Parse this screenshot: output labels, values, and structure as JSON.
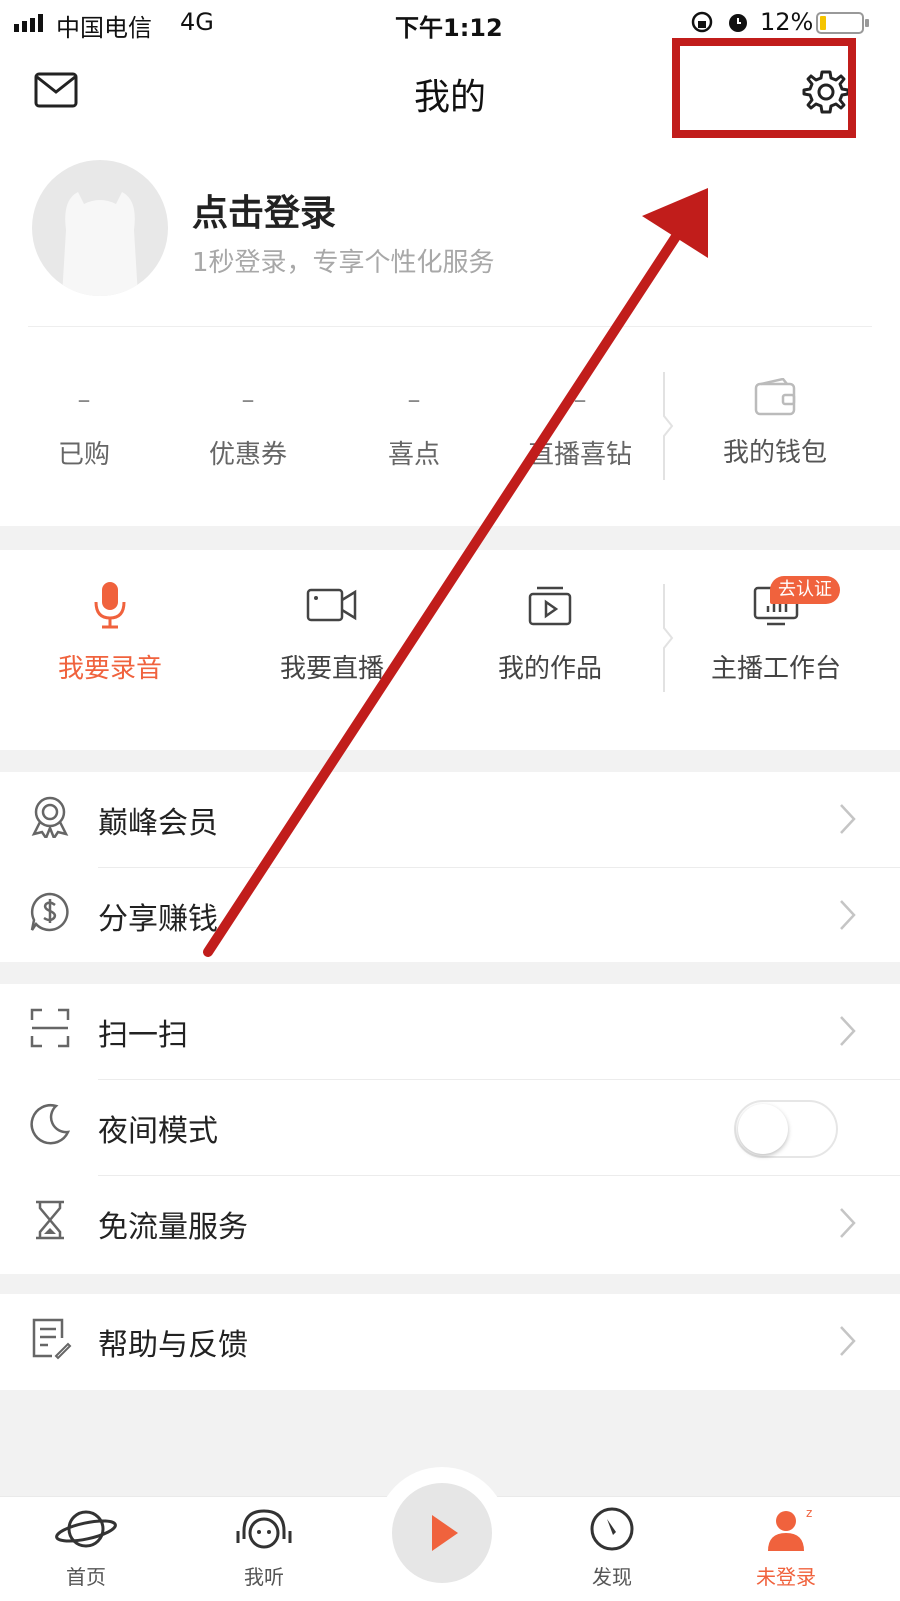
{
  "status_bar": {
    "carrier": "中国电信",
    "network": "4G",
    "time": "下午1:12",
    "battery": "12%"
  },
  "header": {
    "title": "我的",
    "mail_icon": "mail-icon",
    "settings_icon": "gear-icon"
  },
  "profile": {
    "login_title": "点击登录",
    "login_subtitle": "1秒登录，专享个性化服务"
  },
  "stats": [
    {
      "value": "–",
      "label": "已购"
    },
    {
      "value": "–",
      "label": "优惠券"
    },
    {
      "value": "–",
      "label": "喜点"
    },
    {
      "value": "–",
      "label": "直播喜钻"
    }
  ],
  "wallet": {
    "label": "我的钱包"
  },
  "tools": [
    {
      "label": "我要录音",
      "icon": "microphone-icon"
    },
    {
      "label": "我要直播",
      "icon": "video-camera-icon"
    },
    {
      "label": "我的作品",
      "icon": "works-icon"
    },
    {
      "label": "主播工作台",
      "icon": "workbench-icon",
      "badge": "去认证"
    }
  ],
  "list_group_1": [
    {
      "label": "巅峰会员",
      "icon": "badge-icon"
    },
    {
      "label": "分享赚钱",
      "icon": "dollar-icon"
    }
  ],
  "list_group_2": [
    {
      "label": "扫一扫",
      "icon": "scan-icon"
    },
    {
      "label": "夜间模式",
      "icon": "moon-icon",
      "toggle": "off"
    },
    {
      "label": "免流量服务",
      "icon": "hourglass-icon"
    }
  ],
  "list_group_3": [
    {
      "label": "帮助与反馈",
      "icon": "document-icon"
    }
  ],
  "tabbar": [
    {
      "label": "首页",
      "icon": "planet-icon"
    },
    {
      "label": "我听",
      "icon": "headphones-icon"
    },
    {
      "label": "",
      "icon": "play-icon"
    },
    {
      "label": "发现",
      "icon": "compass-icon"
    },
    {
      "label": "未登录",
      "icon": "user-icon"
    }
  ],
  "colors": {
    "accent": "#f0623d",
    "annotation": "#c11d1b",
    "badge": "#f0623d"
  }
}
